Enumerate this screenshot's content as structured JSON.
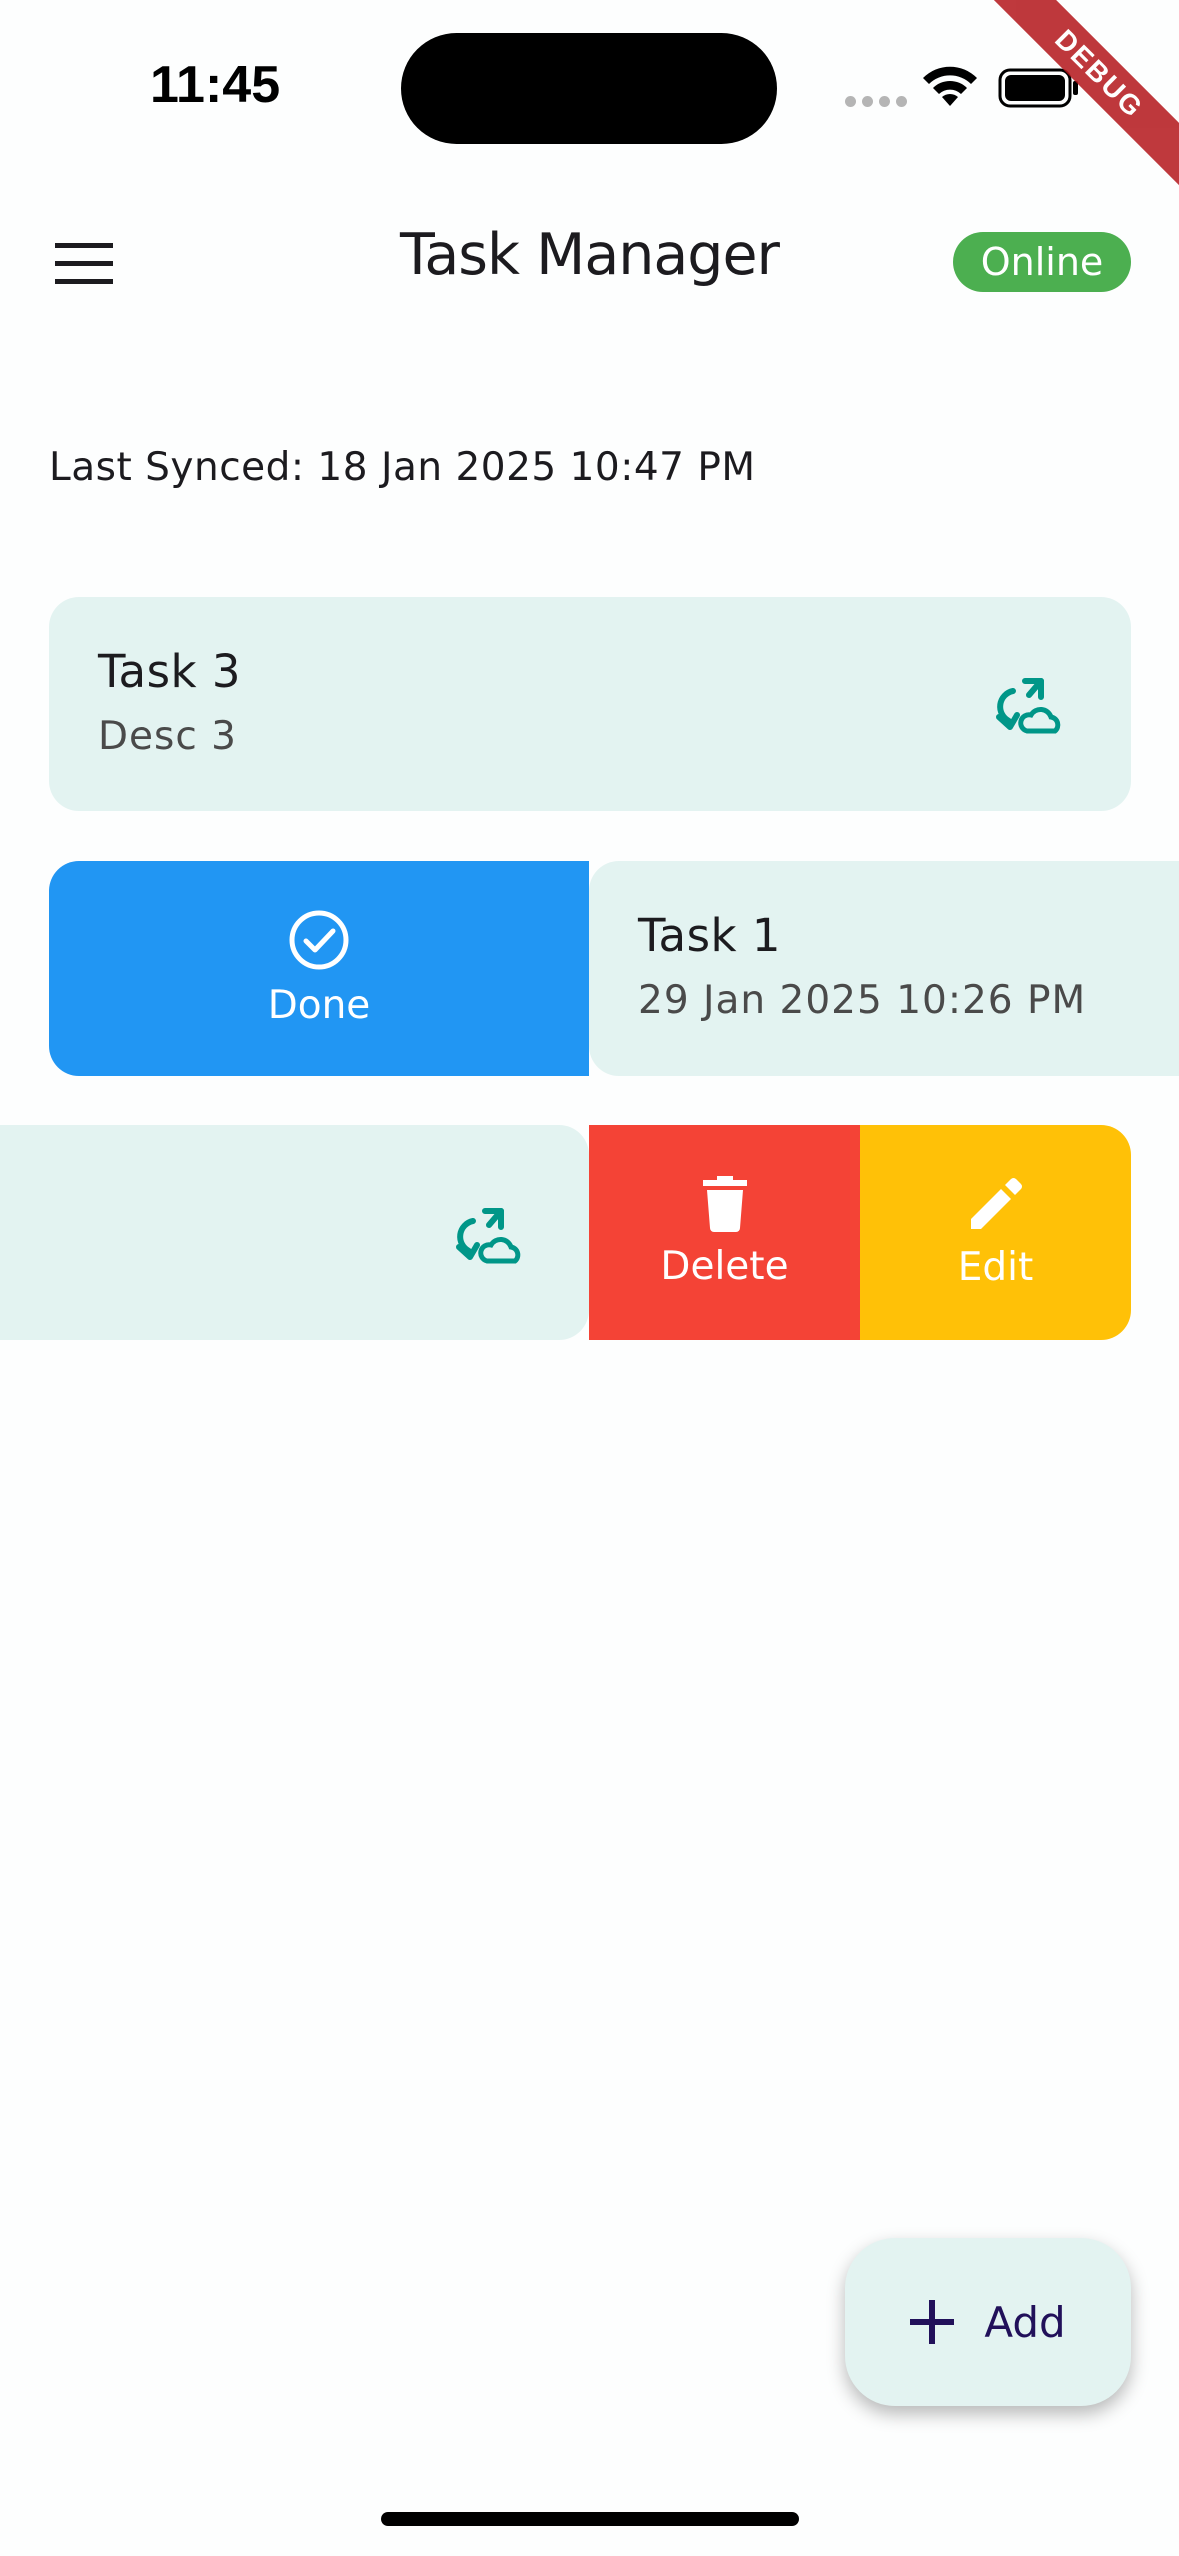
{
  "status_bar": {
    "time": "11:45"
  },
  "debug_banner": {
    "label": "DEBUG"
  },
  "app_bar": {
    "title": "Task Manager",
    "status_badge": "Online"
  },
  "last_synced": "Last Synced: 18 Jan 2025 10:47 PM",
  "tasks": [
    {
      "title": "Task 3",
      "subtitle": "Desc 3",
      "icon": "cloud-sync-icon"
    },
    {
      "title": "Task 1",
      "subtitle": "29 Jan 2025 10:26 PM",
      "swipe_action": "Done"
    },
    {
      "title": "",
      "subtitle": "",
      "icon": "cloud-sync-icon",
      "swipe_actions": [
        "Delete",
        "Edit"
      ]
    }
  ],
  "actions": {
    "done_label": "Done",
    "delete_label": "Delete",
    "edit_label": "Edit"
  },
  "fab": {
    "label": "Add"
  },
  "colors": {
    "card_bg": "#e3f3f1",
    "online_green": "#4caf50",
    "done_blue": "#2196f3",
    "delete_red": "#f44336",
    "edit_amber": "#ffc107",
    "sync_icon_teal": "#009688",
    "fab_text": "#21105a"
  }
}
